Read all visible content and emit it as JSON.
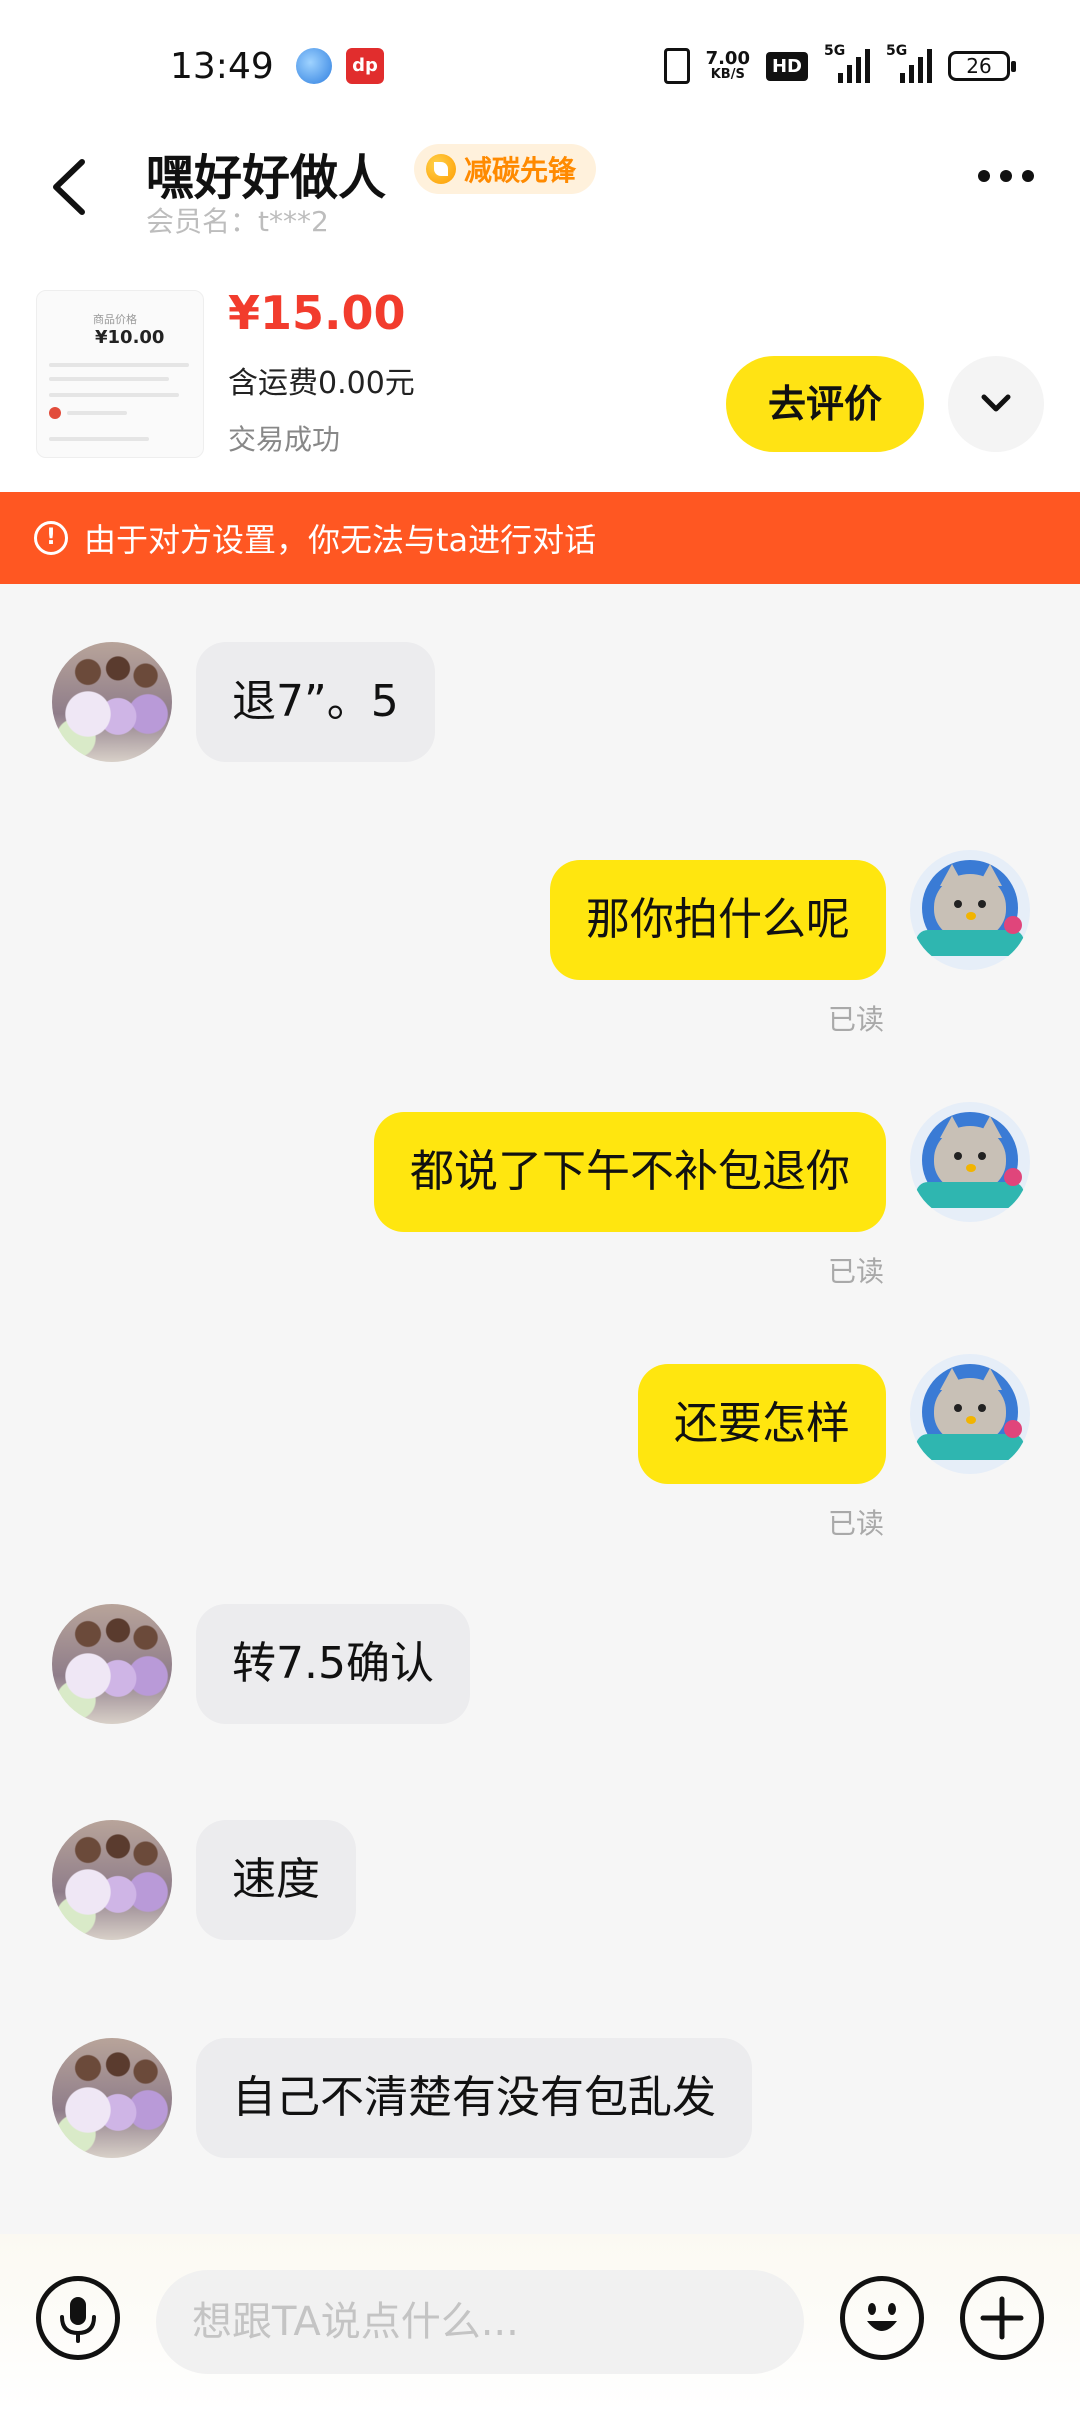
{
  "status_bar": {
    "time": "13:49",
    "app_badge": "dp",
    "net_speed": "7.00",
    "net_unit": "KB/S",
    "hd_label": "HD",
    "signal1_label": "5G",
    "signal2_label": "5G",
    "battery": "26"
  },
  "header": {
    "name": "嘿好好做人",
    "badge_label": "减碳先锋",
    "member_label": "会员名：t***2"
  },
  "order": {
    "thumb_title": "商品价格",
    "thumb_price": "¥10.00",
    "price": "¥15.00",
    "shipping": "含运费0.00元",
    "status": "交易成功",
    "review_button": "去评价"
  },
  "alert": {
    "icon_text": "!",
    "text": "由于对方设置，你无法与ta进行对话"
  },
  "messages": [
    {
      "side": "left",
      "text": "退7”。5"
    },
    {
      "side": "right",
      "text": "那你拍什么呢",
      "read": "已读"
    },
    {
      "side": "right",
      "text": "都说了下午不补包退你",
      "read": "已读"
    },
    {
      "side": "right",
      "text": "还要怎样",
      "read": "已读"
    },
    {
      "side": "left",
      "text": "转7.5确认"
    },
    {
      "side": "left",
      "text": "速度"
    },
    {
      "side": "left",
      "text": "自己不清楚有没有包乱发"
    }
  ],
  "input": {
    "placeholder": "想跟TA说点什么..."
  },
  "icons": {
    "back": "back-arrow-icon",
    "more": "more-dots-icon",
    "expand": "chevron-down-icon",
    "mic": "microphone-icon",
    "emoji": "emoji-icon",
    "plus": "plus-icon"
  },
  "colors": {
    "accent_yellow": "#ffe60f",
    "alert_orange": "#ff5722",
    "price_red": "#f23c2d"
  }
}
